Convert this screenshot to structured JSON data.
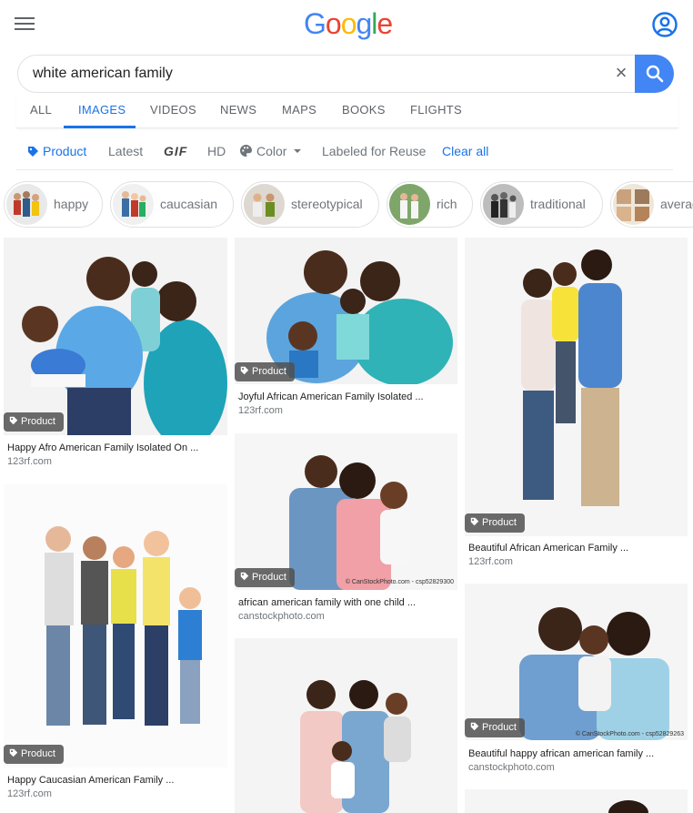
{
  "header": {
    "logo_letters": [
      "G",
      "o",
      "o",
      "g",
      "l",
      "e"
    ],
    "menu_icon": "hamburger-menu-icon",
    "account_icon": "account-circle-icon"
  },
  "search": {
    "query": "white american family",
    "clear_icon": "close-icon",
    "search_icon": "search-icon"
  },
  "tabs": [
    {
      "label": "ALL",
      "active": false
    },
    {
      "label": "IMAGES",
      "active": true
    },
    {
      "label": "VIDEOS",
      "active": false
    },
    {
      "label": "NEWS",
      "active": false
    },
    {
      "label": "MAPS",
      "active": false
    },
    {
      "label": "BOOKS",
      "active": false
    },
    {
      "label": "FLIGHTS",
      "active": false
    }
  ],
  "filters": {
    "product": "Product",
    "latest": "Latest",
    "gif": "GIF",
    "hd": "HD",
    "color": "Color",
    "labeled": "Labeled for Reuse",
    "clear_all": "Clear all"
  },
  "chips": [
    {
      "label": "happy"
    },
    {
      "label": "caucasian"
    },
    {
      "label": "stereotypical"
    },
    {
      "label": "rich"
    },
    {
      "label": "traditional"
    },
    {
      "label": "average"
    }
  ],
  "results": [
    {
      "badge": "Product",
      "title": "Happy Afro American Family Isolated On ...",
      "source": "123rf.com",
      "watermark": ""
    },
    {
      "badge": "Product",
      "title": "Happy Caucasian American Family ...",
      "source": "123rf.com",
      "watermark": ""
    },
    {
      "badge": "Product",
      "title": "Joyful African American Family Isolated ...",
      "source": "123rf.com",
      "watermark": ""
    },
    {
      "badge": "Product",
      "title": "african american family with one child ...",
      "source": "canstockphoto.com",
      "watermark": "© CanStockPhoto.com - csp52829300"
    },
    {
      "badge": "",
      "title": "",
      "source": "",
      "watermark": ""
    },
    {
      "badge": "Product",
      "title": "Beautiful African American Family ...",
      "source": "123rf.com",
      "watermark": ""
    },
    {
      "badge": "Product",
      "title": "Beautiful happy african american family ...",
      "source": "canstockphoto.com",
      "watermark": "© CanStockPhoto.com - csp52829263"
    },
    {
      "badge": "",
      "title": "",
      "source": "",
      "watermark": ""
    }
  ],
  "colors": {
    "accent": "#1a73e8",
    "search_button": "#4285f4",
    "badge_bg": "#505050"
  }
}
